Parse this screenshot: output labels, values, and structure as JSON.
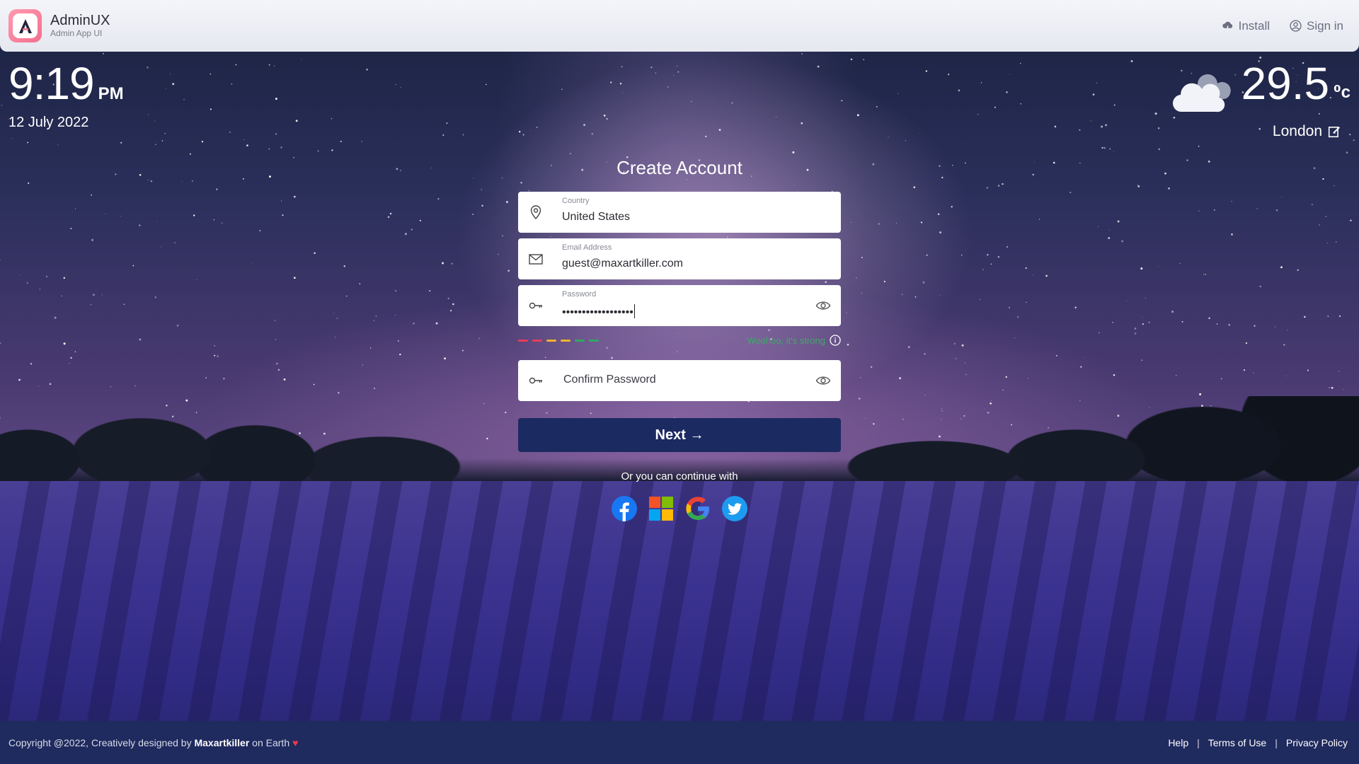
{
  "header": {
    "brand_name": "AdminUX",
    "brand_sub": "Admin App UI",
    "install_label": "Install",
    "signin_label": "Sign in"
  },
  "clock": {
    "time": "9:19",
    "ampm": "PM",
    "date": "12 July 2022"
  },
  "weather": {
    "temperature": "29.5",
    "unit": "⁰c",
    "city": "London",
    "icon": "cloud-icon"
  },
  "form": {
    "title": "Create Account",
    "country": {
      "label": "Country",
      "value": "United States",
      "icon": "location-pin-icon"
    },
    "email": {
      "label": "Email Address",
      "value": "guest@maxartkiller.com",
      "icon": "envelope-icon"
    },
    "password": {
      "label": "Password",
      "value": "••••••••••••••••••",
      "icon": "key-icon"
    },
    "strength": {
      "text": "Woohoo, it's strong",
      "bar_colors": [
        "#e53e5a",
        "#e53e5a",
        "#f2b32b",
        "#f2b32b",
        "#2fa864",
        "#2fa864"
      ]
    },
    "confirm_password": {
      "placeholder": "Confirm Password",
      "icon": "key-icon"
    },
    "next_label": "Next →",
    "continue_text": "Or you can continue with",
    "socials": [
      "facebook",
      "windows",
      "google",
      "twitter"
    ]
  },
  "footer": {
    "copyright_prefix": "Copyright @2022, Creatively designed by ",
    "author": "Maxartkiller",
    "copyright_suffix": " on Earth",
    "heart": "♥",
    "links": [
      "Help",
      "Terms of Use",
      "Privacy Policy"
    ],
    "separator": "|"
  },
  "colors": {
    "primary_button": "#1c2a62",
    "footer_bg": "#1f2a5e",
    "header_bg": "#eef0f6",
    "strength_text": "#3fa86a"
  }
}
